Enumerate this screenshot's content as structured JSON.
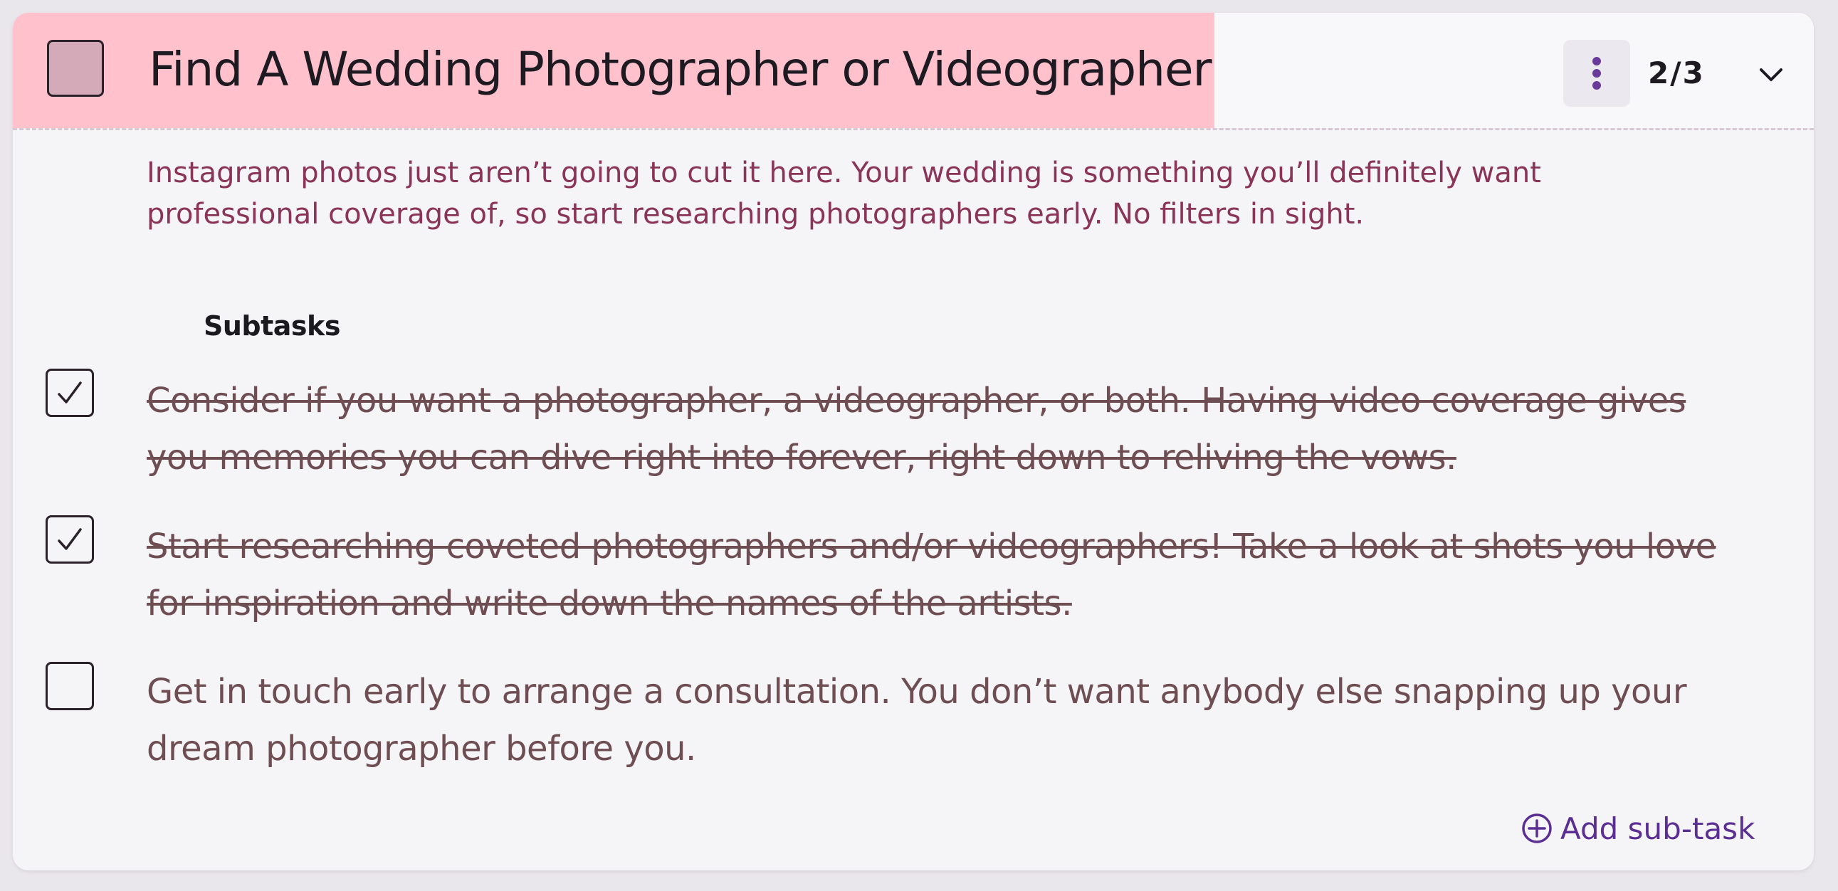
{
  "task": {
    "title": "Find A Wedding Photographer or Videographer",
    "progress": "2/3",
    "completed": false,
    "description": "Instagram photos just aren’t going to cut it here. Your wedding is something you’ll definitely want professional coverage of, so start researching photographers early. No filters in sight.",
    "menu_icon": "more-vertical-icon",
    "expand_icon": "chevron-down-icon"
  },
  "subtasks": {
    "heading": "Subtasks",
    "items": [
      {
        "text": "Consider if you want a photographer, a videographer, or both. Having video coverage gives you memories you can dive right into forever, right down to reliving the vows.",
        "done": true
      },
      {
        "text": "Start researching coveted photographers and/or videographers! Take a look at shots you love for inspiration and write down the names of the artists.",
        "done": true
      },
      {
        "text": "Get in touch early to arrange a consultation. You don’t want anybody else snapping up your dream photographer before you.",
        "done": false
      }
    ],
    "add_label": "Add sub-task",
    "add_icon": "plus-circle-icon"
  },
  "colors": {
    "title_band": "#ffc1cc",
    "description": "#8a3458",
    "subtask_text": "#6e4e53",
    "accent": "#5a2e92"
  }
}
